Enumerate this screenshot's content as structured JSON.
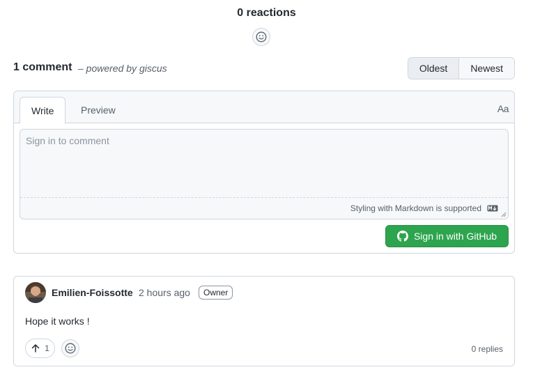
{
  "reactions": {
    "title": "0 reactions",
    "add_icon": "smiley-icon"
  },
  "comments_header": {
    "count_label": "1 comment",
    "powered_by": "– powered by giscus",
    "sort": {
      "options": [
        "Oldest",
        "Newest"
      ],
      "selected": "Oldest"
    }
  },
  "editor": {
    "tabs": [
      "Write",
      "Preview"
    ],
    "active_tab": "Write",
    "format_toggle": "Aa",
    "placeholder": "Sign in to comment",
    "markdown_hint": "Styling with Markdown is supported",
    "markdown_icon": "markdown-icon",
    "signin_label": "Sign in with GitHub",
    "signin_icon": "github-icon",
    "accent_color": "#2da44e"
  },
  "comment": {
    "author": "Emilien-Foissotte",
    "time": "2 hours ago",
    "badge": "Owner",
    "body": "Hope it works !",
    "upvotes": "1",
    "replies": "0 replies"
  }
}
